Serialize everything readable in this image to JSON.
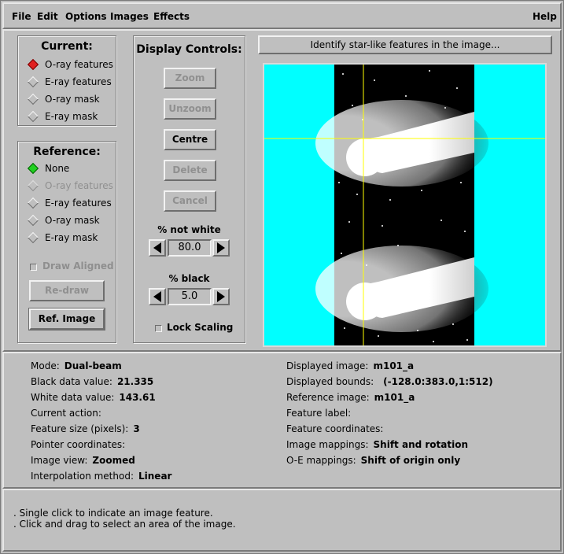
{
  "menubar": {
    "file": "File",
    "edit": "Edit",
    "options": "Options",
    "images": "Images",
    "effects": "Effects",
    "help": "Help"
  },
  "current": {
    "title": "Current:",
    "items": [
      {
        "label": "O-ray features",
        "selected": true
      },
      {
        "label": "E-ray features",
        "selected": false
      },
      {
        "label": "O-ray mask",
        "selected": false
      },
      {
        "label": "E-ray mask",
        "selected": false
      }
    ]
  },
  "reference": {
    "title": "Reference:",
    "items": [
      {
        "label": "None",
        "selected": true
      },
      {
        "label": "O-ray features",
        "disabled": true
      },
      {
        "label": "E-ray features"
      },
      {
        "label": "O-ray mask"
      },
      {
        "label": "E-ray mask"
      }
    ],
    "draw_aligned": "Draw Aligned",
    "redraw": "Re-draw",
    "ref_image": "Ref. Image"
  },
  "display_controls": {
    "title": "Display Controls:",
    "zoom": "Zoom",
    "unzoom": "Unzoom",
    "centre": "Centre",
    "delete": "Delete",
    "cancel": "Cancel",
    "not_white_label": "% not white",
    "not_white_value": "80.0",
    "black_label": "% black",
    "black_value": "5.0",
    "lock_scaling": "Lock Scaling"
  },
  "status": {
    "prompt": "Identify star-like features in the image..."
  },
  "info_left": [
    {
      "label": "Mode:",
      "value": "Dual-beam"
    },
    {
      "label": "Black data value:",
      "value": "21.335"
    },
    {
      "label": "White data value:",
      "value": "143.61"
    },
    {
      "label": "Current action:",
      "value": ""
    },
    {
      "label": "Feature size (pixels):",
      "value": "3"
    },
    {
      "label": "Pointer coordinates:",
      "value": ""
    },
    {
      "label": "Image view:",
      "value": "Zoomed"
    },
    {
      "label": "Interpolation method:",
      "value": "Linear"
    }
  ],
  "info_right": [
    {
      "label": "Displayed image:",
      "value": "m101_a"
    },
    {
      "label": "Displayed bounds:",
      "value": "(-128.0:383.0,1:512)"
    },
    {
      "label": "Reference image:",
      "value": "m101_a"
    },
    {
      "label": "Feature label:",
      "value": ""
    },
    {
      "label": "Feature coordinates:",
      "value": ""
    },
    {
      "label": "Image mappings:",
      "value": "Shift and rotation"
    },
    {
      "label": "O-E mappings:",
      "value": "Shift of origin only"
    }
  ],
  "messages": {
    "line1": ".  Single click to indicate an image feature.",
    "line2": ". Click and drag to select an area of the image."
  },
  "colors": {
    "background": "#bfbfbf",
    "image_background": "#00ffff",
    "crosshair": "#ffff00",
    "selected_current": "#e02020",
    "selected_reference": "#20d020"
  }
}
